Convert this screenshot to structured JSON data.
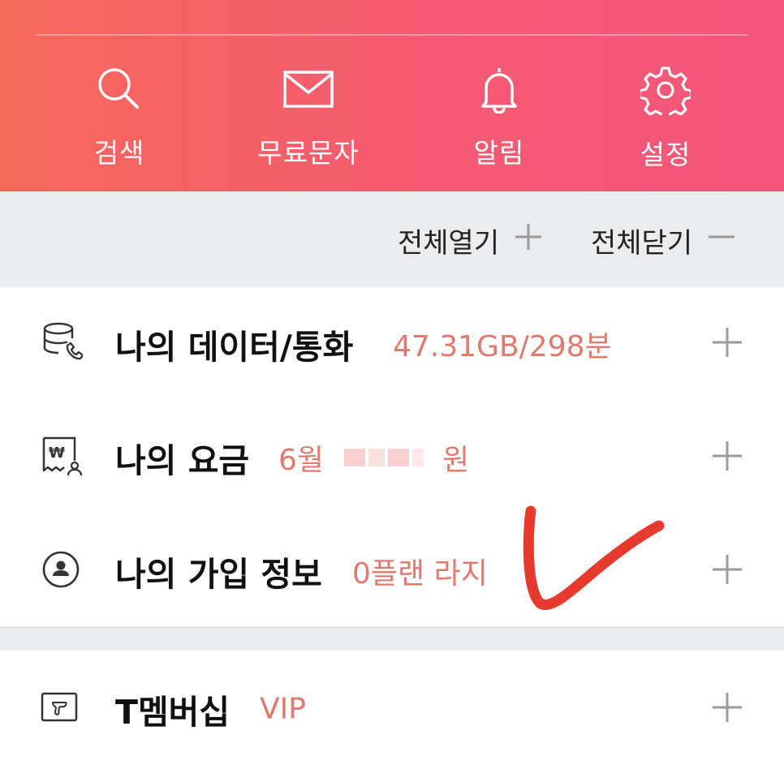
{
  "quick_menu": [
    {
      "label": "검색",
      "icon": "search-icon"
    },
    {
      "label": "무료문자",
      "icon": "envelope-icon"
    },
    {
      "label": "알림",
      "icon": "bell-icon"
    },
    {
      "label": "설정",
      "icon": "gear-icon"
    }
  ],
  "controls": {
    "expand_all": "전체열기",
    "collapse_all": "전체닫기"
  },
  "rows": [
    {
      "title": "나의 데이터/통화",
      "value": "47.31GB/298분",
      "icon": "data-call-icon"
    },
    {
      "title": "나의 요금",
      "month": "6월",
      "unit": "원",
      "icon": "bill-icon"
    },
    {
      "title": "나의 가입 정보",
      "value": "0플랜 라지",
      "icon": "user-circle-icon"
    },
    {
      "title": "T멤버십",
      "value": "VIP",
      "icon": "membership-card-icon"
    }
  ],
  "colors": {
    "header_gradient_start": "#f6685a",
    "header_gradient_end": "#f2567b",
    "value_text": "#e07a6e",
    "panel_bg": "#ebecee",
    "annotation_mark": "#e63a2e"
  }
}
